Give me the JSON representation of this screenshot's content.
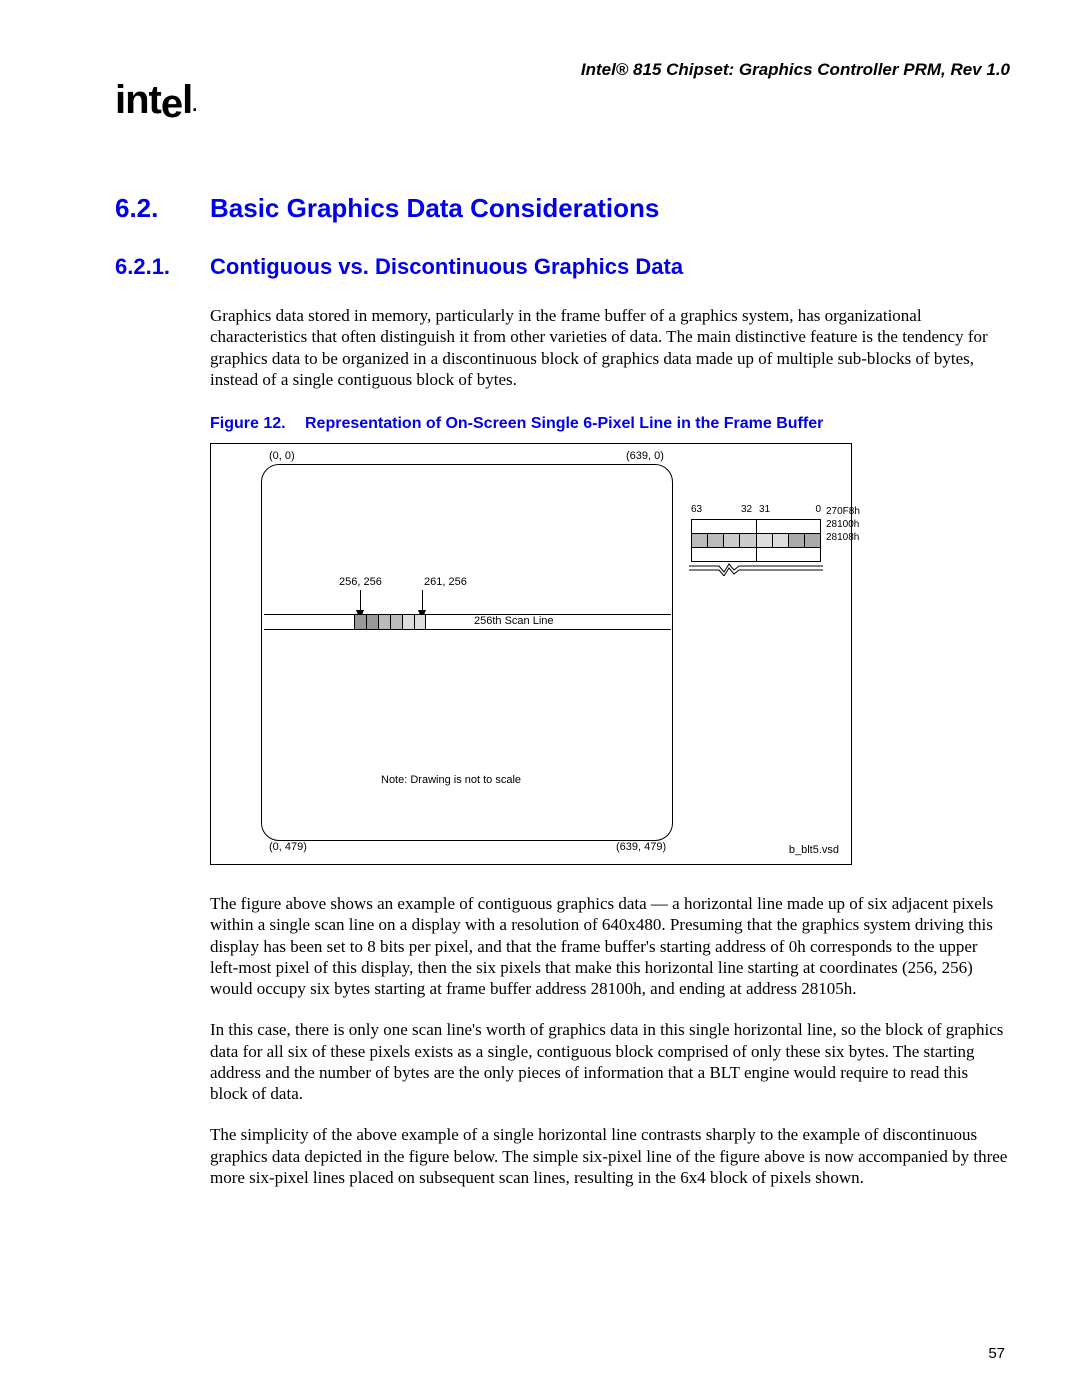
{
  "header": "Intel® 815 Chipset: Graphics Controller PRM, Rev 1.0",
  "logo": "intel",
  "section": {
    "num": "6.2.",
    "title": "Basic Graphics Data Considerations"
  },
  "subsection": {
    "num": "6.2.1.",
    "title": "Contiguous vs. Discontinuous Graphics Data"
  },
  "para1": "Graphics data stored in memory, particularly in the frame buffer of a graphics system, has organizational characteristics that often distinguish it from other varieties of data. The main distinctive feature is the tendency for graphics data to be organized in a discontinuous block of graphics data made up of multiple sub-blocks of bytes, instead of a single contiguous block of bytes.",
  "figcap": {
    "label": "Figure 12.",
    "title": "Representation of On-Screen Single 6-Pixel Line in the Frame Buffer"
  },
  "fig": {
    "tl": "(0, 0)",
    "tr": "(639, 0)",
    "bl": "(0, 479)",
    "br": "(639, 479)",
    "c1": "256, 256",
    "c2": "261, 256",
    "scan": "256th Scan Line",
    "note": "Note: Drawing is not to scale",
    "bits": {
      "b63": "63",
      "b32": "32",
      "b31": "31",
      "b0": "0"
    },
    "addr": {
      "a1": "270F8h",
      "a2": "28100h",
      "a3": "28108h"
    },
    "file": "b_blt5.vsd"
  },
  "para2": "The figure above shows an example of contiguous graphics data — a horizontal line made up of six adjacent pixels within a single scan line on a display with a resolution of 640x480. Presuming that the graphics system driving this display has been set to 8 bits per pixel, and that the frame buffer's starting address of 0h corresponds to the upper left-most pixel of this display, then the six pixels that make this horizontal line starting at coordinates (256, 256) would occupy six bytes starting at frame buffer address 28100h, and ending at address 28105h.",
  "para3": "In this case, there is only one scan line's worth of graphics data in this single horizontal line, so the block of graphics data for all six of these pixels exists as a single, contiguous block comprised of only these six bytes. The starting address and the number of bytes are the only pieces of information that a BLT engine would require to read this block of data.",
  "para4": "The simplicity of the above example of a single horizontal line contrasts sharply to the example of discontinuous graphics data depicted in the figure below. The simple six-pixel line of the figure above is now accompanied by three more six-pixel lines placed on subsequent scan lines, resulting in the 6x4 block of pixels shown.",
  "pagenum": "57"
}
